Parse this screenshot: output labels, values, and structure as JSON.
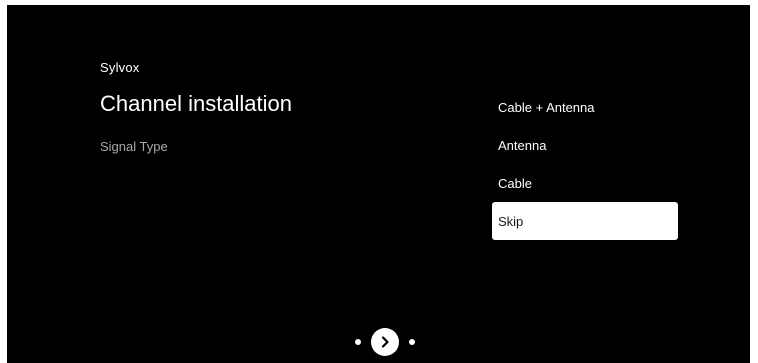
{
  "brand": "Sylvox",
  "page": {
    "title": "Channel installation",
    "subtitle": "Signal Type"
  },
  "signal_options": [
    {
      "label": "Cable + Antenna",
      "selected": false
    },
    {
      "label": "Antenna",
      "selected": false
    },
    {
      "label": "Cable",
      "selected": false
    },
    {
      "label": "Skip",
      "selected": true
    }
  ],
  "pager": {
    "next_icon": "chevron-right-icon"
  },
  "colors": {
    "background": "#000000",
    "text": "#ffffff",
    "muted_text": "#a8a8a8",
    "highlight": "#ffffff",
    "highlight_text": "#1a1a1a"
  }
}
